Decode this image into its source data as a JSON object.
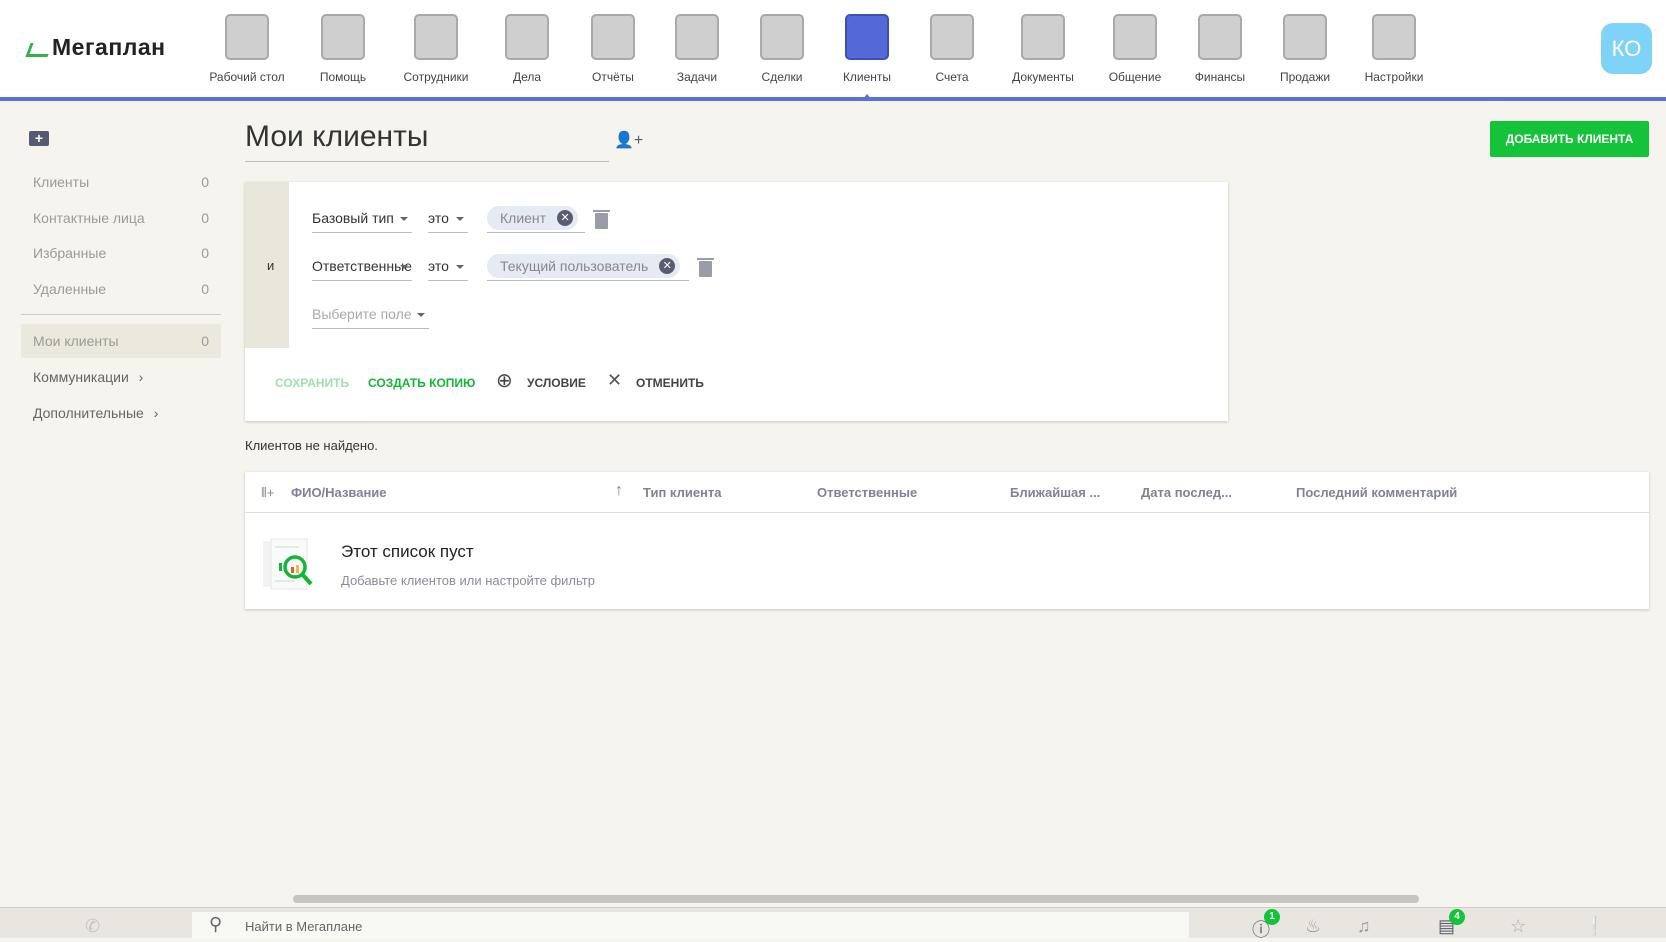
{
  "app": {
    "logo": "Мегаплан",
    "avatar": "КО",
    "accent": "#5d6fdc",
    "green": "#14c33a"
  },
  "nav": [
    {
      "label": "Рабочий стол",
      "icon": "desktop-icon"
    },
    {
      "label": "Помощь",
      "icon": "lifebuoy-icon"
    },
    {
      "label": "Сотрудники",
      "icon": "employees-icon"
    },
    {
      "label": "Дела",
      "icon": "clock-icon"
    },
    {
      "label": "Отчёты",
      "icon": "reports-icon"
    },
    {
      "label": "Задачи",
      "icon": "clipboard-icon"
    },
    {
      "label": "Сделки",
      "icon": "briefcase-icon"
    },
    {
      "label": "Клиенты",
      "icon": "address-book-icon",
      "active": true
    },
    {
      "label": "Счета",
      "icon": "invoice-icon"
    },
    {
      "label": "Документы",
      "icon": "folder-icon"
    },
    {
      "label": "Общение",
      "icon": "chat-icon"
    },
    {
      "label": "Финансы",
      "icon": "safe-icon"
    },
    {
      "label": "Продажи",
      "icon": "sales-briefcase-icon"
    },
    {
      "label": "Настройки",
      "icon": "gear-icon"
    }
  ],
  "sidebar": {
    "items": [
      {
        "label": "Клиенты",
        "count": "0"
      },
      {
        "label": "Контактные лица",
        "count": "0"
      },
      {
        "label": "Избранные",
        "count": "0"
      },
      {
        "label": "Удаленные",
        "count": "0"
      },
      {
        "label": "Мои клиенты",
        "count": "0"
      }
    ],
    "groups": [
      {
        "label": "Коммуникации"
      },
      {
        "label": "Дополнительные"
      }
    ]
  },
  "page": {
    "title": "Мои клиенты",
    "add_button": "ДОБАВИТЬ КЛИЕНТА",
    "not_found": "Клиентов не найдено."
  },
  "filter": {
    "conjunction": "и",
    "rows": [
      {
        "field": "Базовый тип",
        "op": "это",
        "value": "Клиент"
      },
      {
        "field": "Ответственные",
        "op": "это",
        "value": "Текущий пользователь"
      }
    ],
    "new_field_placeholder": "Выберите поле",
    "save": "СОХРАНИТЬ",
    "copy": "СОЗДАТЬ КОПИЮ",
    "condition": "УСЛОВИЕ",
    "cancel": "ОТМЕНИТЬ"
  },
  "table": {
    "columns": [
      "ФИО/Название",
      "Тип клиента",
      "Ответственные",
      "Ближайшая ...",
      "Дата послед...",
      "Последний комментарий"
    ],
    "empty_title": "Этот список пуст",
    "empty_subtitle": "Добавьте клиентов или настройте фильтр"
  },
  "bottom": {
    "search_placeholder": "Найти в Мегаплане",
    "alerts_badge": "1",
    "messages_badge": "4"
  }
}
